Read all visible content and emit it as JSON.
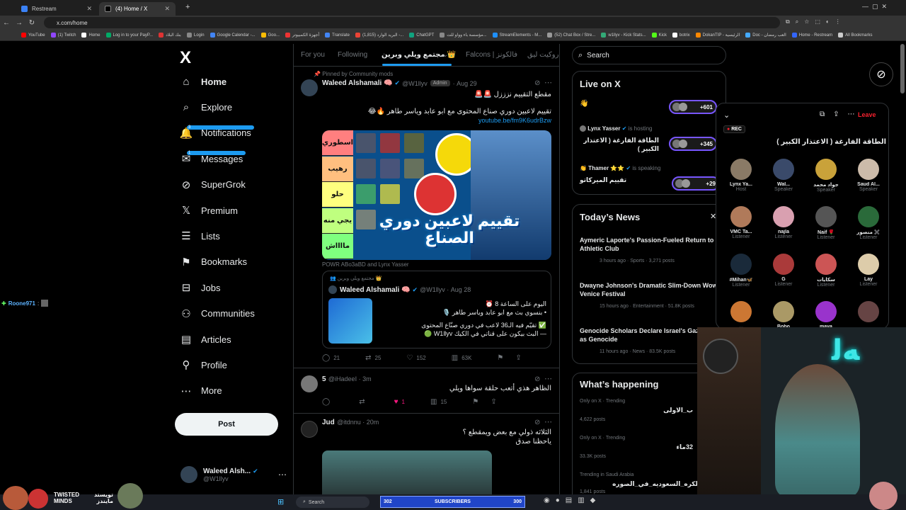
{
  "browser": {
    "tabs": [
      {
        "label": "Restream",
        "color": "#3b82f6"
      },
      {
        "label": "(4) Home / X",
        "color": "#000000"
      }
    ],
    "url": "x.com/home",
    "bookmarks": [
      "YouTube",
      "(1) Twitch",
      "Home",
      "Log in to your PayP...",
      "بنك البلاد",
      "Login",
      "Google Calendar -...",
      "Goo...",
      "أجهزة الكمبيوتر",
      "Translate",
      "(1,815) البريد الوارد -...",
      "ChatGPT",
      "مؤسسة باء وواو للت...",
      "StreamElements - M...",
      "(52) Chat Box / Stre...",
      "w1llyv - Kick Stats...",
      "Kick",
      "botrix",
      "DokanTIP - الرئيسية",
      "Doc - العب رمضان",
      "Home - Restream",
      "All Bookmarks"
    ]
  },
  "overlay_chat": {
    "user": "Roone971",
    "sep": ":"
  },
  "nav": {
    "logo": "X",
    "items": [
      {
        "label": "Home",
        "icon": "home-icon",
        "glyph": "⌂"
      },
      {
        "label": "Explore",
        "icon": "search-icon",
        "glyph": "⌕"
      },
      {
        "label": "Notifications",
        "icon": "bell-icon",
        "glyph": "🔔",
        "badge": "3"
      },
      {
        "label": "Messages",
        "icon": "mail-icon",
        "glyph": "✉",
        "badge": "1"
      },
      {
        "label": "SuperGrok",
        "icon": "grok-icon",
        "glyph": "⊘"
      },
      {
        "label": "Premium",
        "icon": "x-premium-icon",
        "glyph": "𝕏"
      },
      {
        "label": "Lists",
        "icon": "list-icon",
        "glyph": "☰"
      },
      {
        "label": "Bookmarks",
        "icon": "bookmark-icon",
        "glyph": "⚑"
      },
      {
        "label": "Jobs",
        "icon": "briefcase-icon",
        "glyph": "⊟"
      },
      {
        "label": "Communities",
        "icon": "people-icon",
        "glyph": "⚇"
      },
      {
        "label": "Articles",
        "icon": "article-icon",
        "glyph": "▤"
      },
      {
        "label": "Profile",
        "icon": "person-icon",
        "glyph": "⚲"
      },
      {
        "label": "More",
        "icon": "more-icon",
        "glyph": "⋯"
      }
    ],
    "post_label": "Post",
    "account": {
      "name": "Waleed Alsh...",
      "handle": "@W1llyv"
    }
  },
  "timeline": {
    "tabs": [
      "For you",
      "Following",
      "مجتمع ويلي وبرين 👑",
      "Falcons | فالكونز",
      "روكيت ليق"
    ],
    "posts": [
      {
        "pinned": "Pinned by Community mods",
        "name": "Waleed Alshamali 🧠",
        "handle": "@W1llyv",
        "badge": "Admin",
        "date": "Aug 29",
        "text1": "مقطع التقييم نزززل 🚨🚨",
        "text2": "تقييم لاعبين دوري صناع المحتوى مع ابو عابد وياسر طاهر 🔥😂",
        "link": "youtube.be/fm9K6udrBzw",
        "image_tiers": [
          "اسطوري",
          "رهيب",
          "حلو",
          "يجي منه",
          "مااااش"
        ],
        "image_tier_colors": [
          "#ff7f7f",
          "#ffbf7f",
          "#ffff7f",
          "#bfff7f",
          "#7fff7f"
        ],
        "image_title": "تقييم لاعبين دوري الصناع",
        "tagged": "POWR ABo3aBD and Lynx Yasser",
        "quote": {
          "community": "مجتمع ويلي وبرين 👑",
          "name": "Waleed Alshamali 🧠",
          "handle": "@W1llyv",
          "date": "Aug 28",
          "lines": [
            "اليوم على الساعة 8 ⏰",
            "• بنسوي بث مع ابو عابد وياسر طاهر 🎙️",
            "✅ تقيّم فيه الـ36 لاعب في دوري صنّاع المحتوى",
            "— البث بيكون على قناتي في الكيك W1llyv 🟢"
          ]
        },
        "stats": {
          "replies": "21",
          "reposts": "25",
          "likes": "152",
          "views": "63K"
        }
      },
      {
        "name": "5",
        "handle": "@iHadeeI",
        "date": "3m",
        "text1": "الظاهر هذي أتعب حلقة سواها ويلي",
        "stats": {
          "replies": "",
          "reposts": "",
          "likes": "1",
          "views": "15"
        }
      },
      {
        "name": "Jud",
        "handle": "@itdnnu",
        "date": "20m",
        "text1": "الثلاثه ذولي مع بعض ويمقطع ؟",
        "text2": "ياحظنا صدق"
      }
    ]
  },
  "right": {
    "search_placeholder": "Search",
    "live": {
      "title": "Live on X",
      "items": [
        {
          "host": "👋",
          "title": "",
          "count": "+601"
        },
        {
          "host": "Lynx Yasser",
          "role": "is hosting",
          "title": "الطاقة الفارغة ( الاعتذار الكبير )",
          "count": "+345"
        },
        {
          "host": "👏 Thamer ⭐⭐",
          "role": "is speaking",
          "title": "تقييم الميركاتو",
          "count": "+29"
        }
      ]
    },
    "news": {
      "title": "Today’s News",
      "items": [
        {
          "headline": "Aymeric Laporte's Passion-Fueled Return to Athletic Club",
          "meta": "3 hours ago · Sports · 3,271 posts"
        },
        {
          "headline": "Dwayne Johnson's Dramatic Slim-Down Wows Venice Festival",
          "meta": "15 hours ago · Entertainment · 51.8K posts"
        },
        {
          "headline": "Genocide Scholars Declare Israel's Gaza War as Genocide",
          "meta": "11 hours ago · News · 83.5K posts"
        }
      ]
    },
    "happening": {
      "title": "What’s happening",
      "items": [
        {
          "meta": "Only on X · Trending",
          "name": "ب_الاولى",
          "posts": "4,622 posts"
        },
        {
          "meta": "Only on X · Trending",
          "name": "32ماء",
          "posts": "33.3K posts"
        },
        {
          "meta": "Trending in Saudi Arabia",
          "name": "الكره_السعوديه_في_الصوره",
          "posts": "1,841 posts"
        }
      ]
    }
  },
  "space": {
    "leave": "Leave",
    "rec": "REC",
    "title": "الطاقة الفارغة ( الاعتذار الكبير )",
    "members": [
      {
        "name": "Lynx Ya...",
        "role": "Host",
        "color": "#8a7a66"
      },
      {
        "name": "Wal...",
        "role": "Speaker",
        "color": "#3a4a6a"
      },
      {
        "name": "جواد محمد",
        "role": "Speaker",
        "color": "#c9a23a"
      },
      {
        "name": "Saud Al...",
        "role": "Speaker",
        "color": "#ccbbaa"
      },
      {
        "name": "VMC Ta...",
        "role": "Listener",
        "color": "#b07a5a"
      },
      {
        "name": "najla",
        "role": "Listener",
        "color": "#d9a0b0"
      },
      {
        "name": "Naif 🌹",
        "role": "Listener",
        "color": "#555555"
      },
      {
        "name": "منصور ✖️",
        "role": "Listener",
        "color": "#2a6a3a"
      },
      {
        "name": "#Mihan🦋",
        "role": "Listener",
        "color": "#1a2a3a"
      },
      {
        "name": "G",
        "role": "Listener",
        "color": "#aa3a3a"
      },
      {
        "name": "سكايات",
        "role": "Listener",
        "color": "#cc5555"
      },
      {
        "name": "Lay",
        "role": "Listener",
        "color": "#ddccaa"
      },
      {
        "name": "...",
        "role": "",
        "color": "#cc7733"
      },
      {
        "name": "Bobo",
        "role": "",
        "color": "#aa9966"
      },
      {
        "name": "maya",
        "role": "",
        "color": "#9933cc"
      },
      {
        "name": "",
        "role": "",
        "color": "#664444"
      }
    ]
  },
  "taskbar": {
    "search": "Search",
    "subs_left": "302",
    "subs_label": "SUBSCRIBERS",
    "subs_right": "300",
    "stream_logo": "TWISTED MINDS",
    "stream_ar": "تويستد مايندز"
  }
}
